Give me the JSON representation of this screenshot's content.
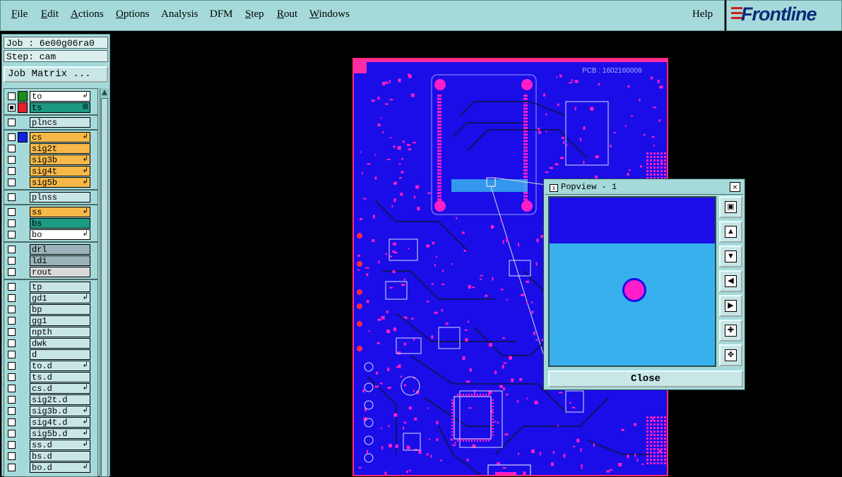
{
  "menubar": {
    "items": [
      {
        "label": "File",
        "underline": "F",
        "rest": "ile"
      },
      {
        "label": "Edit",
        "underline": "E",
        "rest": "dit"
      },
      {
        "label": "Actions",
        "underline": "A",
        "rest": "ctions"
      },
      {
        "label": "Options",
        "underline": "O",
        "rest": "ptions"
      },
      {
        "label": "Analysis",
        "underline": "",
        "rest": "Analysis"
      },
      {
        "label": "DFM",
        "underline": "",
        "rest": "DFM"
      },
      {
        "label": "Step",
        "underline": "S",
        "rest": "tep"
      },
      {
        "label": "Rout",
        "underline": "R",
        "rest": "out"
      },
      {
        "label": "Windows",
        "underline": "W",
        "rest": "indows"
      }
    ],
    "help": "Help"
  },
  "logo": {
    "text": "Frontline",
    "icon": "frontline-stripes-icon"
  },
  "job": {
    "label": "Job : 6e00g06ra0",
    "step": "Step: cam",
    "matrix_button": "Job Matrix ..."
  },
  "layers": [
    {
      "name": "to",
      "color": "#1f8a1f",
      "bg": "#ffffff",
      "checked": false,
      "flag": "↲"
    },
    {
      "name": "ts",
      "color": "#e8202a",
      "bg": "#1d9a82",
      "checked": true,
      "flag": "⊞"
    },
    {
      "name": "plncs",
      "color": "",
      "bg": "#c9e6e6",
      "checked": false,
      "flag": ""
    },
    {
      "name": "cs",
      "color": "#1020e0",
      "bg": "#f6b949",
      "checked": false,
      "flag": "↲"
    },
    {
      "name": "sig2t",
      "color": "",
      "bg": "#f6b949",
      "checked": false,
      "flag": ""
    },
    {
      "name": "sig3b",
      "color": "",
      "bg": "#f6b949",
      "checked": false,
      "flag": "↲"
    },
    {
      "name": "sig4t",
      "color": "",
      "bg": "#f6b949",
      "checked": false,
      "flag": "↲"
    },
    {
      "name": "sig5b",
      "color": "",
      "bg": "#f6b949",
      "checked": false,
      "flag": "↲"
    },
    {
      "name": "plnss",
      "color": "",
      "bg": "#c9e6e6",
      "checked": false,
      "flag": ""
    },
    {
      "name": "ss",
      "color": "",
      "bg": "#f6b949",
      "checked": false,
      "flag": "↲"
    },
    {
      "name": "bs",
      "color": "",
      "bg": "#1d9a82",
      "checked": false,
      "flag": ""
    },
    {
      "name": "bo",
      "color": "",
      "bg": "#ffffff",
      "checked": false,
      "flag": "↲"
    },
    {
      "name": "drl",
      "color": "",
      "bg": "#9ab3b8",
      "checked": false,
      "flag": ""
    },
    {
      "name": "ldi",
      "color": "",
      "bg": "#9ab3b8",
      "checked": false,
      "flag": ""
    },
    {
      "name": "rout",
      "color": "",
      "bg": "#d9d9d9",
      "checked": false,
      "flag": ""
    },
    {
      "name": "tp",
      "color": "",
      "bg": "#c9e6e6",
      "checked": false,
      "flag": ""
    },
    {
      "name": "gd1",
      "color": "",
      "bg": "#c9e6e6",
      "checked": false,
      "flag": "↲"
    },
    {
      "name": "bp",
      "color": "",
      "bg": "#c9e6e6",
      "checked": false,
      "flag": ""
    },
    {
      "name": "gg1",
      "color": "",
      "bg": "#c9e6e6",
      "checked": false,
      "flag": ""
    },
    {
      "name": "npth",
      "color": "",
      "bg": "#c9e6e6",
      "checked": false,
      "flag": ""
    },
    {
      "name": "dwk",
      "color": "",
      "bg": "#c9e6e6",
      "checked": false,
      "flag": ""
    },
    {
      "name": "d",
      "color": "",
      "bg": "#c9e6e6",
      "checked": false,
      "flag": ""
    },
    {
      "name": "to.d",
      "color": "",
      "bg": "#c9e6e6",
      "checked": false,
      "flag": "↲"
    },
    {
      "name": "ts.d",
      "color": "",
      "bg": "#c9e6e6",
      "checked": false,
      "flag": ""
    },
    {
      "name": "cs.d",
      "color": "",
      "bg": "#c9e6e6",
      "checked": false,
      "flag": "↲"
    },
    {
      "name": "sig2t.d",
      "color": "",
      "bg": "#c9e6e6",
      "checked": false,
      "flag": ""
    },
    {
      "name": "sig3b.d",
      "color": "",
      "bg": "#c9e6e6",
      "checked": false,
      "flag": "↲"
    },
    {
      "name": "sig4t.d",
      "color": "",
      "bg": "#c9e6e6",
      "checked": false,
      "flag": "↲"
    },
    {
      "name": "sig5b.d",
      "color": "",
      "bg": "#c9e6e6",
      "checked": false,
      "flag": "↲"
    },
    {
      "name": "ss.d",
      "color": "",
      "bg": "#c9e6e6",
      "checked": false,
      "flag": "↲"
    },
    {
      "name": "bs.d",
      "color": "",
      "bg": "#c9e6e6",
      "checked": false,
      "flag": ""
    },
    {
      "name": "bo.d",
      "color": "",
      "bg": "#c9e6e6",
      "checked": false,
      "flag": "↲"
    }
  ],
  "board": {
    "pcb_label": "PCB : 1602160008"
  },
  "popview": {
    "title": "Popview - 1",
    "menu_icon": "x",
    "close_x": "×",
    "close_button": "Close",
    "tools": [
      "zoom-fit-icon",
      "pan-up-icon",
      "pan-down-icon",
      "pan-left-icon",
      "pan-right-icon",
      "zoom-in-icon",
      "zoom-out-icon"
    ]
  },
  "colors": {
    "panel": "#a6dada",
    "board": "#1a0de8",
    "pad": "#ff1ec8",
    "highlight": "#39b0ee"
  }
}
